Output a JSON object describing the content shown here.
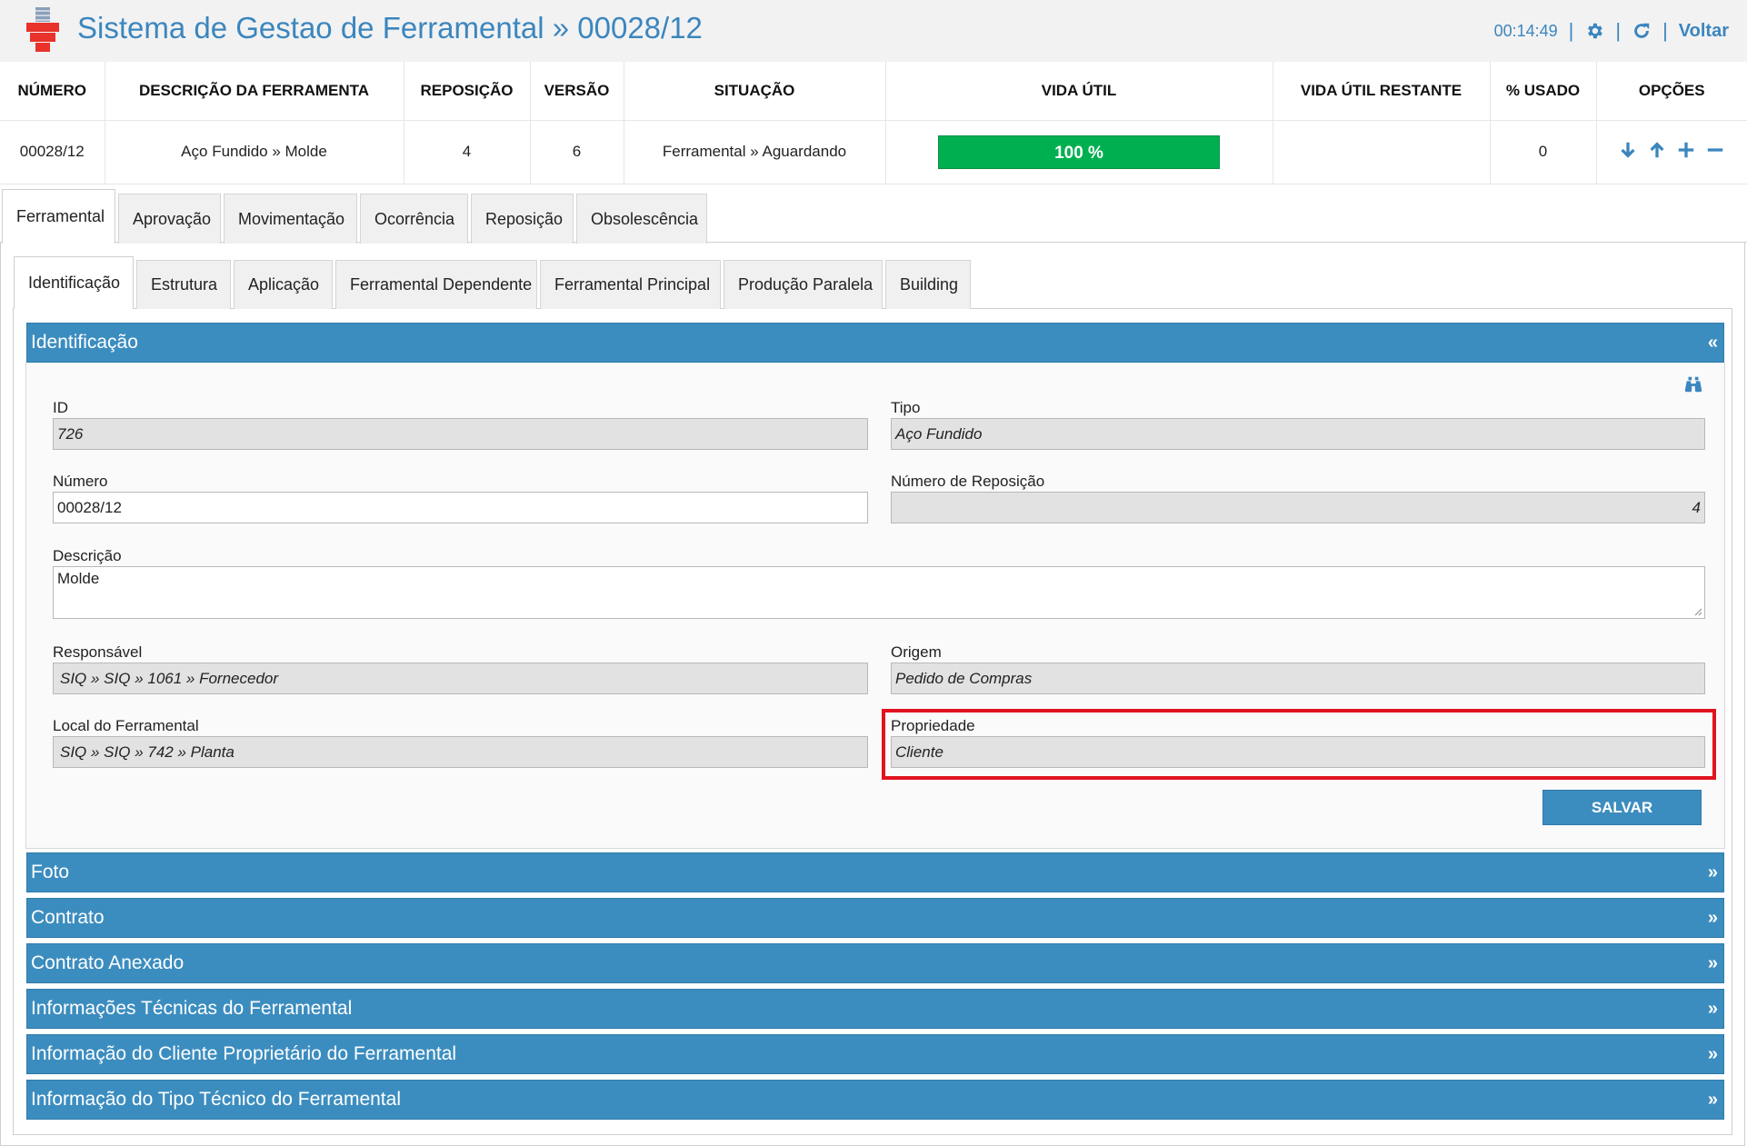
{
  "header": {
    "title": "Sistema de Gestao de Ferramental » 00028/12",
    "time": "00:14:49",
    "separator": "|",
    "back_label": "Voltar",
    "icons": [
      "gear-icon",
      "refresh-icon"
    ]
  },
  "summary": {
    "columns": [
      "NÚMERO",
      "DESCRIÇÃO DA FERRAMENTA",
      "REPOSIÇÃO",
      "VERSÃO",
      "SITUAÇÃO",
      "VIDA ÚTIL",
      "VIDA ÚTIL RESTANTE",
      "% USADO",
      "OPÇÕES"
    ],
    "row": {
      "numero": "00028/12",
      "descricao": "Aço Fundido » Molde",
      "reposicao": "4",
      "versao": "6",
      "situacao": "Ferramental » Aguardando",
      "vida_util_label": "100 %",
      "vida_util_percent": 100,
      "vida_util_restante": "",
      "usado": "0",
      "options_icons": [
        "arrow-down-icon",
        "arrow-up-icon",
        "plus-icon",
        "minus-icon"
      ]
    }
  },
  "tabs_main": [
    {
      "label": "Ferramental",
      "active": true
    },
    {
      "label": "Aprovação",
      "active": false
    },
    {
      "label": "Movimentação",
      "active": false
    },
    {
      "label": "Ocorrência",
      "active": false
    },
    {
      "label": "Reposição",
      "active": false
    },
    {
      "label": "Obsolescência",
      "active": false
    }
  ],
  "tabs_sub": [
    {
      "label": "Identificação",
      "active": true
    },
    {
      "label": "Estrutura",
      "active": false
    },
    {
      "label": "Aplicação",
      "active": false
    },
    {
      "label": "Ferramental Dependente",
      "active": false
    },
    {
      "label": "Ferramental Principal",
      "active": false
    },
    {
      "label": "Produção Paralela",
      "active": false
    },
    {
      "label": "Building",
      "active": false
    }
  ],
  "identificacao": {
    "title": "Identificação",
    "collapse_icon": "«",
    "form": {
      "id_label": "ID",
      "id_value": "726",
      "tipo_label": "Tipo",
      "tipo_value": "Aço Fundido",
      "numero_label": "Número",
      "numero_value": "00028/12",
      "num_reposicao_label": "Número de Reposição",
      "num_reposicao_value": "4",
      "descricao_label": "Descrição",
      "descricao_value": "Molde",
      "responsavel_label": "Responsável",
      "responsavel_value": "SIQ  »  SIQ  » 1061 » Fornecedor",
      "origem_label": "Origem",
      "origem_value": "Pedido de Compras",
      "local_label": "Local do Ferramental",
      "local_value": "SIQ  »  SIQ  » 742 » Planta",
      "propriedade_label": "Propriedade",
      "propriedade_value": "Cliente"
    },
    "save_label": "SALVAR"
  },
  "sections": [
    {
      "title": "Foto",
      "chev": "»"
    },
    {
      "title": "Contrato",
      "chev": "»"
    },
    {
      "title": "Contrato Anexado",
      "chev": "»"
    },
    {
      "title": "Informações Técnicas do Ferramental",
      "chev": "»"
    },
    {
      "title": "Informação do Cliente Proprietário do Ferramental",
      "chev": "»"
    },
    {
      "title": "Informação do Tipo Técnico do Ferramental",
      "chev": "»"
    }
  ],
  "colors": {
    "brand_blue": "#3b86be",
    "accordion_blue": "#3c8dbf",
    "progress_green": "#00b050",
    "highlight_red": "#e0141e"
  }
}
